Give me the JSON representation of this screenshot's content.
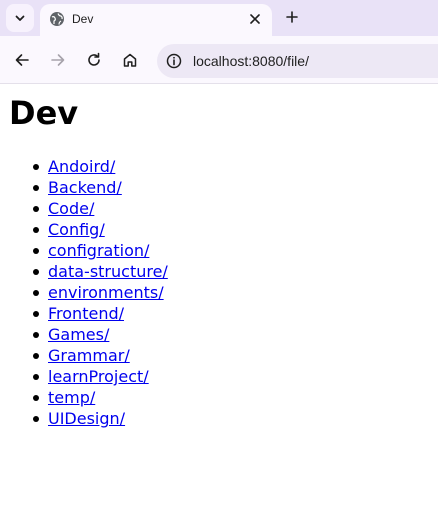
{
  "browser": {
    "tab": {
      "title": "Dev"
    },
    "address": {
      "url": "localhost:8080/file/"
    }
  },
  "page": {
    "heading": "Dev",
    "entries": [
      {
        "label": "Andoird/"
      },
      {
        "label": "Backend/"
      },
      {
        "label": "Code/"
      },
      {
        "label": "Config/"
      },
      {
        "label": "configration/"
      },
      {
        "label": "data-structure/"
      },
      {
        "label": "environments/"
      },
      {
        "label": "Frontend/"
      },
      {
        "label": "Games/"
      },
      {
        "label": "Grammar/"
      },
      {
        "label": "learnProject/"
      },
      {
        "label": "temp/"
      },
      {
        "label": "UIDesign/"
      }
    ]
  },
  "icons": {
    "tab_search": "chevron-down-icon",
    "favicon": "globe-icon",
    "close": "close-icon",
    "new_tab": "plus-icon",
    "back": "arrow-left-icon",
    "forward": "arrow-right-icon",
    "reload": "reload-icon",
    "home": "home-icon",
    "site_info": "info-icon"
  },
  "colors": {
    "tabstrip": "#e9e2f7",
    "toolbar": "#fbf8fe",
    "omnibox": "#ede8f5",
    "link": "#0000ee"
  }
}
